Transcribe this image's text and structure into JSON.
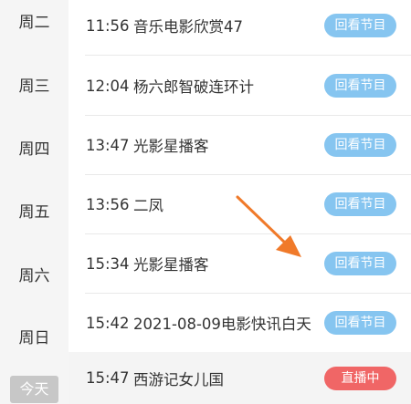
{
  "days": [
    "周二",
    "周三",
    "周四",
    "周五",
    "周六",
    "周日",
    "今天"
  ],
  "programs": [
    {
      "time": "11:56",
      "title": "音乐电影欣赏47",
      "action": "回看节目"
    },
    {
      "time": "12:04",
      "title": "杨六郎智破连环计",
      "action": "回看节目"
    },
    {
      "time": "13:47",
      "title": "光影星播客",
      "action": "回看节目"
    },
    {
      "time": "13:56",
      "title": "二凤",
      "action": "回看节目"
    },
    {
      "time": "15:34",
      "title": "光影星播客",
      "action": "回看节目"
    },
    {
      "time": "15:42",
      "title": "2021-08-09电影快讯白天",
      "action": "回看节目"
    },
    {
      "time": "15:47",
      "title": "西游记女儿国",
      "action": "直播中"
    }
  ],
  "colors": {
    "replay_badge": "#86c5f0",
    "live_badge": "#f06666",
    "annotation_arrow": "#f07a2a"
  },
  "annotation": {
    "icon": "orange-arrow-icon"
  }
}
